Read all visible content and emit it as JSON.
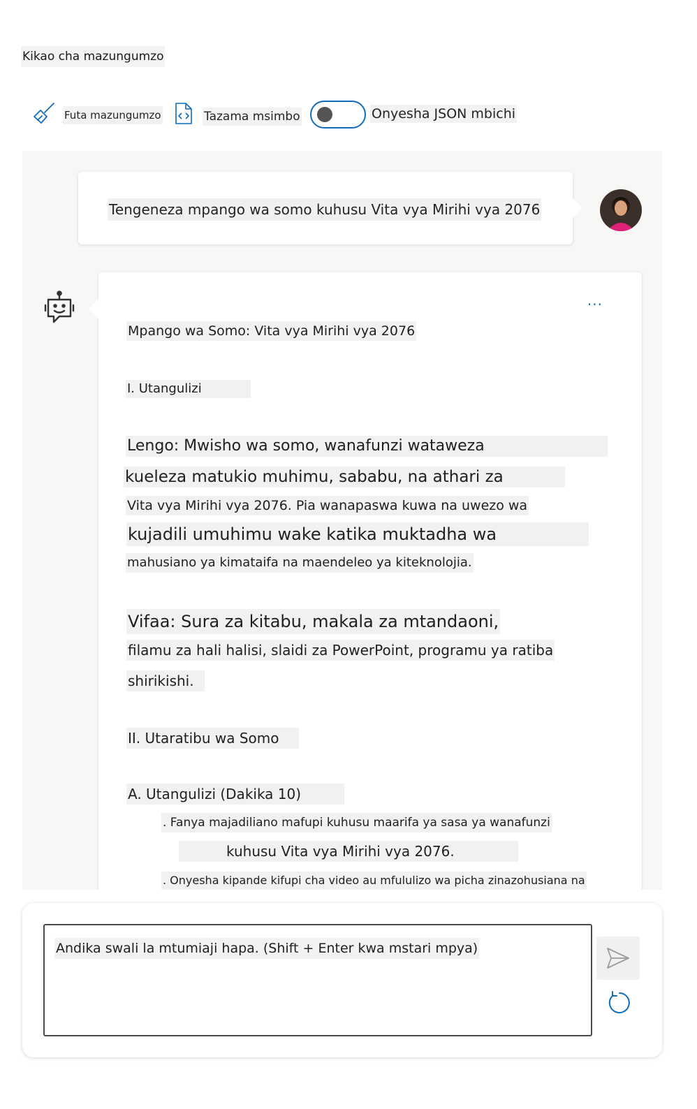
{
  "page": {
    "title": "Kikao cha mazungumzo"
  },
  "toolbar": {
    "clear_label": "Futa mazungumzo",
    "code_label": "Tazama msimbo",
    "json_toggle_label": "Onyesha JSON mbichi",
    "json_toggle_on": false
  },
  "chat": {
    "user_message": "Tengeneza mpango wa somo kuhusu Vita vya Mirihi vya 2076",
    "assistant_more": "...",
    "assistant_lines": [
      "Mpango wa Somo: Vita vya Mirihi vya 2076",
      "I. Utangulizi",
      "Lengo: Mwisho wa somo, wanafunzi wataweza",
      "kueleza matukio muhimu, sababu, na athari za",
      "Vita vya Mirihi vya 2076. Pia wanapaswa kuwa na uwezo wa",
      "kujadili umuhimu wake katika muktadha wa",
      "mahusiano ya kimataifa na maendeleo ya kiteknolojia.",
      "Vifaa: Sura za kitabu, makala za mtandaoni,",
      "filamu za hali halisi, slaidi za PowerPoint, programu ya ratiba",
      "shirikishi.",
      "II. Utaratibu wa Somo",
      "A. Utangulizi (Dakika 10)",
      ". Fanya majadiliano mafupi kuhusu maarifa ya sasa ya wanafunzi",
      "kuhusu Vita vya Mirihi vya 2076.",
      ". Onyesha kipande kifupi cha video au mfululizo wa picha zinazohusiana na"
    ]
  },
  "input": {
    "placeholder": "Andika swali la mtumiaji hapa. (Shift + Enter kwa mstari mpya)"
  },
  "colors": {
    "accent": "#0f6cbd",
    "chat_background": "#f7f7f6"
  }
}
